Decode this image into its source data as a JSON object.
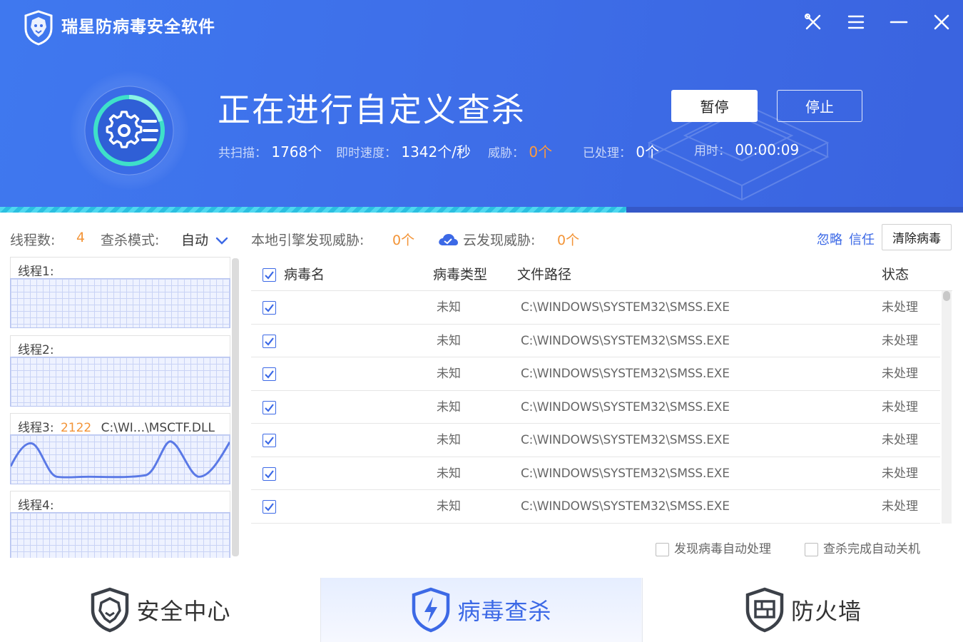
{
  "app": {
    "title": "瑞星防病毒安全软件"
  },
  "window_controls": [
    "tools-icon",
    "menu-icon",
    "minimize-icon",
    "close-icon"
  ],
  "scan": {
    "title": "正在进行自定义查杀",
    "progress": 0.65,
    "stats": {
      "scanned_label": "共扫描：",
      "scanned_value": "1768个",
      "speed_label": "即时速度：",
      "speed_value": "1342个/秒",
      "threat_label": "威胁：",
      "threat_value": "0个",
      "handled_label": "已处理：",
      "handled_value": "0个",
      "time_label": "用时：",
      "time_value": "00:00:09"
    },
    "pause_label": "暂停",
    "stop_label": "停止"
  },
  "toolbar": {
    "threads_label": "线程数:",
    "threads_value": "4",
    "mode_label": "查杀模式:",
    "mode_value": "自动",
    "local_label": "本地引擎发现威胁:",
    "local_value": "0个",
    "cloud_label": "云发现威胁:",
    "cloud_value": "0个",
    "ignore_label": "忽略",
    "trust_label": "信任",
    "clean_label": "清除病毒"
  },
  "threads": [
    {
      "label": "线程1:",
      "count": "",
      "file": ""
    },
    {
      "label": "线程2:",
      "count": "",
      "file": ""
    },
    {
      "label": "线程3:",
      "count": "2122",
      "file": "C:\\WI...\\MSCTF.DLL"
    },
    {
      "label": "线程4:",
      "count": "",
      "file": ""
    }
  ],
  "table": {
    "headers": {
      "name": "病毒名",
      "type": "病毒类型",
      "path": "文件路径",
      "status": "状态"
    },
    "rows": [
      {
        "name": "",
        "type": "未知",
        "path": "C:\\WINDOWS\\SYSTEM32\\SMSS.EXE",
        "status": "未处理",
        "checked": true
      },
      {
        "name": "",
        "type": "未知",
        "path": "C:\\WINDOWS\\SYSTEM32\\SMSS.EXE",
        "status": "未处理",
        "checked": true
      },
      {
        "name": "",
        "type": "未知",
        "path": "C:\\WINDOWS\\SYSTEM32\\SMSS.EXE",
        "status": "未处理",
        "checked": true
      },
      {
        "name": "",
        "type": "未知",
        "path": "C:\\WINDOWS\\SYSTEM32\\SMSS.EXE",
        "status": "未处理",
        "checked": true
      },
      {
        "name": "",
        "type": "未知",
        "path": "C:\\WINDOWS\\SYSTEM32\\SMSS.EXE",
        "status": "未处理",
        "checked": true
      },
      {
        "name": "",
        "type": "未知",
        "path": "C:\\WINDOWS\\SYSTEM32\\SMSS.EXE",
        "status": "未处理",
        "checked": true
      },
      {
        "name": "",
        "type": "未知",
        "path": "C:\\WINDOWS\\SYSTEM32\\SMSS.EXE",
        "status": "未处理",
        "checked": true
      }
    ]
  },
  "options": {
    "auto_handle": "发现病毒自动处理",
    "auto_shutdown": "查杀完成自动关机"
  },
  "nav": {
    "tabs": [
      {
        "label": "安全中心",
        "icon": "lion-shield-icon",
        "active": false
      },
      {
        "label": "病毒查杀",
        "icon": "lightning-shield-icon",
        "active": true
      },
      {
        "label": "防火墙",
        "icon": "firewall-shield-icon",
        "active": false
      }
    ]
  },
  "colors": {
    "header_blue": "#3e6fe9",
    "accent_blue": "#3c69e6",
    "warning_orange": "#f39437",
    "progress_cyan": "#4fd8f0"
  }
}
